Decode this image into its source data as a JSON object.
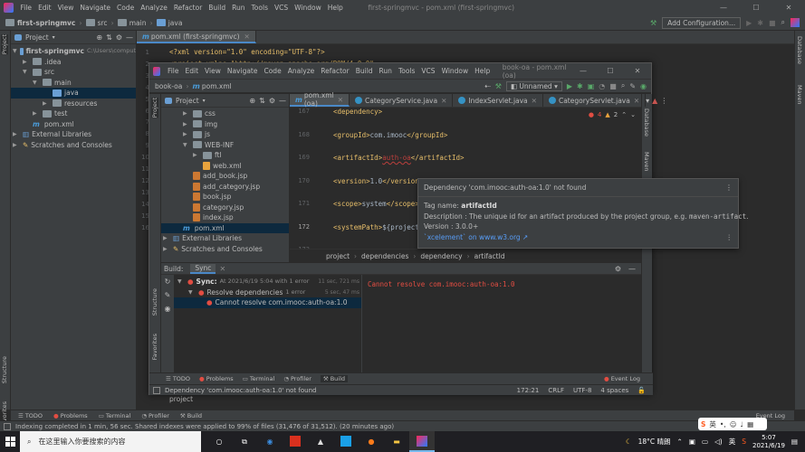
{
  "outer": {
    "menu": [
      "File",
      "Edit",
      "View",
      "Navigate",
      "Code",
      "Analyze",
      "Refactor",
      "Build",
      "Run",
      "Tools",
      "VCS",
      "Window",
      "Help"
    ],
    "title": "first-springmvc - pom.xml (first-springmvc)",
    "breadcrumb": [
      "first-springmvc",
      "src",
      "main",
      "java"
    ],
    "config_label": "Add Configuration...",
    "project_label": "Project",
    "tab_label": "pom.xml (first-springmvc)",
    "tree": [
      {
        "label": "first-springmvc",
        "extra": "C:\\Users\\comput",
        "type": "module",
        "indent": 0,
        "open": true
      },
      {
        "label": ".idea",
        "type": "folder",
        "indent": 1
      },
      {
        "label": "src",
        "type": "folder",
        "indent": 1,
        "open": true
      },
      {
        "label": "main",
        "type": "folder",
        "indent": 2,
        "open": true
      },
      {
        "label": "java",
        "type": "folder-blue",
        "indent": 3,
        "selected": true
      },
      {
        "label": "resources",
        "type": "folder",
        "indent": 3
      },
      {
        "label": "test",
        "type": "folder",
        "indent": 2
      },
      {
        "label": "pom.xml",
        "type": "maven",
        "indent": 1
      },
      {
        "label": "External Libraries",
        "type": "lib",
        "indent": 0
      },
      {
        "label": "Scratches and Consoles",
        "type": "scratch",
        "indent": 0
      }
    ],
    "code": [
      "<?xml version=\"1.0\" encoding=\"UTF-8\"?>",
      "<project xmlns=\"http://maven.apache.org/POM/4.0.0\""
    ],
    "line_numbers": [
      "1",
      "2",
      "3",
      "4",
      "5",
      "6",
      "7",
      "8",
      "9",
      "10",
      "11",
      "12",
      "13",
      "14",
      "15",
      "16"
    ],
    "bottom_crumb": "project",
    "bottom_tools": [
      "TODO",
      "Problems",
      "Terminal",
      "Profiler",
      "Build"
    ],
    "event_log": "Event Log",
    "status": "Indexing completed in 1 min, 56 sec. Shared indexes were applied to 99% of files (31,476 of 31,512). (20 minutes ago)",
    "side_left": [
      "Project",
      "Structure",
      "Favorites"
    ],
    "side_right": [
      "Database",
      "Maven"
    ]
  },
  "inner": {
    "menu": [
      "File",
      "Edit",
      "View",
      "Navigate",
      "Code",
      "Analyze",
      "Refactor",
      "Build",
      "Run",
      "Tools",
      "VCS",
      "Window",
      "Help"
    ],
    "title": "book-oa - pom.xml (oa)",
    "breadcrumb": [
      "book-oa",
      "pom.xml"
    ],
    "run_config": "Unnamed",
    "project_label": "Project",
    "tabs": [
      {
        "label": "pom.xml (oa)",
        "type": "maven",
        "active": true
      },
      {
        "label": "CategoryService.java",
        "type": "class"
      },
      {
        "label": "IndexServlet.java",
        "type": "class"
      },
      {
        "label": "CategoryServlet.java",
        "type": "class"
      }
    ],
    "inspect": {
      "errors": "4",
      "warnings": "2"
    },
    "tree": [
      {
        "label": "css",
        "type": "folder",
        "indent": 2
      },
      {
        "label": "img",
        "type": "folder",
        "indent": 2
      },
      {
        "label": "js",
        "type": "folder",
        "indent": 2
      },
      {
        "label": "WEB-INF",
        "type": "folder",
        "indent": 2,
        "open": true
      },
      {
        "label": "ftl",
        "type": "folder",
        "indent": 3
      },
      {
        "label": "web.xml",
        "type": "xml",
        "indent": 3
      },
      {
        "label": "add_book.jsp",
        "type": "jsp",
        "indent": 2
      },
      {
        "label": "add_category.jsp",
        "type": "jsp",
        "indent": 2
      },
      {
        "label": "book.jsp",
        "type": "jsp",
        "indent": 2
      },
      {
        "label": "category.jsp",
        "type": "jsp",
        "indent": 2
      },
      {
        "label": "index.jsp",
        "type": "jsp",
        "indent": 2
      },
      {
        "label": "pom.xml",
        "type": "maven",
        "indent": 1,
        "selected": true
      },
      {
        "label": "External Libraries",
        "type": "lib",
        "indent": 0
      },
      {
        "label": "Scratches and Consoles",
        "type": "scratch",
        "indent": 0
      }
    ],
    "lines": [
      {
        "n": "167",
        "code": "<dependency>"
      },
      {
        "n": "168",
        "code": "<groupId>com.imooc</groupId>"
      },
      {
        "n": "169",
        "code": "<artifactId>auth-oa</artifactId>"
      },
      {
        "n": "170",
        "code": "<version>1.0</version>"
      },
      {
        "n": "171",
        "code": "<scope>system</scope>"
      },
      {
        "n": "172",
        "code": "<systemPath>${project.basedir}"
      },
      {
        "n": "173",
        "code": ""
      },
      {
        "n": "174",
        "code": ""
      },
      {
        "n": "175",
        "code": ""
      },
      {
        "n": "176",
        "code": ""
      }
    ],
    "code_crumbs": [
      "project",
      "dependencies",
      "dependency",
      "artifactId"
    ],
    "build": {
      "label": "Build:",
      "tab": "Sync",
      "sync_title": "Sync:",
      "sync_time_prefix": "At 2021/6/19 5:04 with 1 error",
      "sync_duration": "11 sec, 721 ms",
      "resolve_label": "Resolve dependencies",
      "resolve_count": "1 error",
      "resolve_duration": "5 sec, 47 ms",
      "error_label": "Cannot resolve com.imooc:auth-oa:1.0",
      "console": "Cannot resolve com.imooc:auth-oa:1.0"
    },
    "bottom_tools": [
      "TODO",
      "Problems",
      "Terminal",
      "Profiler",
      "Build"
    ],
    "event_log": "Event Log",
    "status": "Dependency 'com.imooc:auth-oa:1.0' not found",
    "caret": "172:21",
    "line_sep": "CRLF",
    "encoding": "UTF-8",
    "indent": "4 spaces",
    "side_left": [
      "Project",
      "Structure",
      "Favorites"
    ],
    "side_right": [
      "Database",
      "Maven"
    ]
  },
  "popup": {
    "title": "Dependency 'com.imooc:auth-oa:1.0' not found",
    "tag_label": "Tag name:",
    "tag_value": "artifactId",
    "desc_label": "Description :",
    "desc_value": "The unique id for an artifact produced by the project group, e.g.",
    "desc_code": "maven-artifact",
    "version_label": "Version : 3.0.0+",
    "link": "`xcelement` on www.w3.org ↗"
  },
  "taskbar": {
    "search": "在这里输入你要搜索的内容",
    "weather": "18°C 晴朗",
    "ime": "英",
    "time": "5:07",
    "date": "2021/6/19"
  },
  "colors": {
    "accent": "#4a88c7",
    "error": "#e24d42",
    "selection": "#0d293e",
    "run_green": "#59a869"
  }
}
